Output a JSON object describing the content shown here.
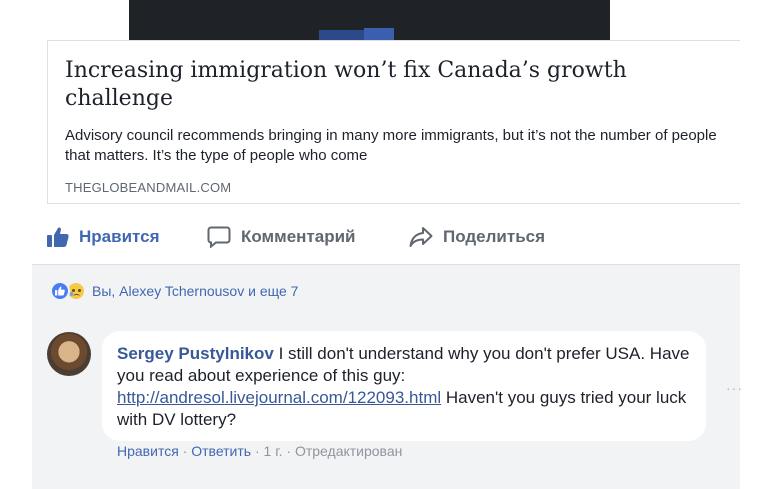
{
  "article": {
    "title": "Increasing immigration won’t fix Canada’s growth challenge",
    "description": "Advisory council recommends bringing in many more immigrants, but it’s not the number of people that matters. It’s the type of people who come",
    "domain": "THEGLOBEANDMAIL.COM"
  },
  "actions": {
    "like": "Нравится",
    "comment": "Комментарий",
    "share": "Поделиться"
  },
  "reactions": {
    "text": "Вы, Alexey Tchernousov и еще 7"
  },
  "comment": {
    "author": "Sergey Pustylnikov",
    "text_before_link": " I still don't understand why you don't prefer USA. Have you read about experience of this guy: ",
    "link": "http://andresol.livejournal.com/122093.html",
    "text_after_link": " Haven't you guys tried your luck with DV lottery?",
    "like_label": "Нравится",
    "reply_label": "Ответить",
    "separator": " · ",
    "time": "1 г.",
    "edited": "Отредактирован",
    "more": "···"
  },
  "colors": {
    "brand_blue": "#4267b2",
    "link_blue": "#385898",
    "panel_bg": "#f2f3f5",
    "text": "#1d2129",
    "muted": "#606770"
  }
}
